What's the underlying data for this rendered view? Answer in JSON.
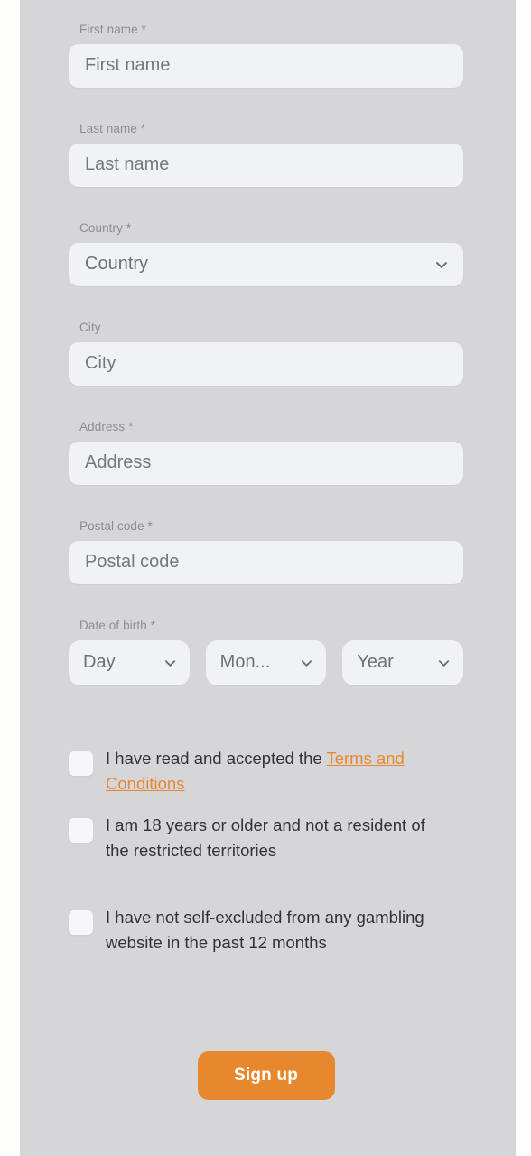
{
  "theme": {
    "page_background": "#d6d6d8",
    "field_background": "#f1f2f4",
    "label_color": "#8d8d8f",
    "text_color": "#333335",
    "accent_color": "#e8882e",
    "checkbox_background": "#f6f7f8"
  },
  "form": {
    "fields": [
      {
        "label": "First name *",
        "placeholder": "First name",
        "value": "",
        "type": "text",
        "name": "first-name"
      },
      {
        "label": "Last name *",
        "placeholder": "Last name",
        "value": "",
        "type": "text",
        "name": "last-name"
      },
      {
        "label": "Country *",
        "placeholder": "Country",
        "value": "Country",
        "type": "select",
        "name": "country"
      },
      {
        "label": "City",
        "placeholder": "City",
        "value": "",
        "type": "text",
        "name": "city"
      },
      {
        "label": "Address *",
        "placeholder": "Address",
        "value": "",
        "type": "text",
        "name": "address"
      },
      {
        "label": "Postal code *",
        "placeholder": "Postal code",
        "value": "",
        "type": "text",
        "name": "postal-code"
      }
    ],
    "date_of_birth": {
      "label": "Date of birth *",
      "day": {
        "value": "Day",
        "name": "dob-day"
      },
      "month": {
        "value": "Mon...",
        "name": "dob-month"
      },
      "year": {
        "value": "Year",
        "name": "dob-year"
      }
    },
    "consents": [
      {
        "name": "terms-and-conditions",
        "text_before": "I have read and accepted the ",
        "link_text": "Terms and Conditions",
        "text_after": "",
        "checked": false
      },
      {
        "name": "age-and-residency",
        "text_before": "I am 18 years or older and not a resident of the restricted territories",
        "link_text": "",
        "text_after": "",
        "checked": false
      },
      {
        "name": "self-exclusion",
        "text_before": "I have not self-excluded from any gambling website in the past 12 months",
        "link_text": "",
        "text_after": "",
        "checked": false
      }
    ],
    "submit": {
      "label": "Sign up",
      "name": "sign-up-button"
    }
  },
  "icons": {
    "chevron_down": "chevron-down-icon"
  }
}
